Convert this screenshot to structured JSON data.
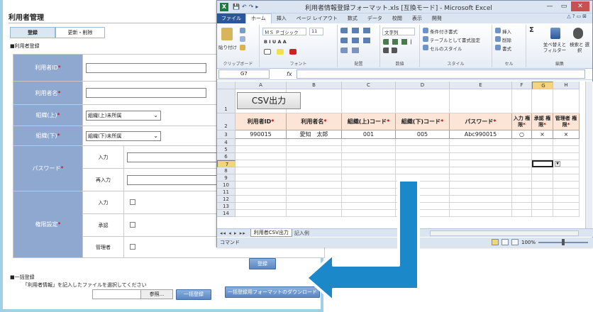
{
  "web": {
    "page_title": "利用者管理",
    "tabs": [
      {
        "label": "登録"
      },
      {
        "label": "更新・削除"
      }
    ],
    "section_label": "■利用者登録",
    "form": {
      "user_id_label": "利用者ID",
      "user_name_label": "利用者名",
      "org_upper_label": "組織(上)",
      "org_upper_value": "組織(上)未所属",
      "org_lower_label": "組織(下)",
      "org_lower_value": "組織(下)未所属",
      "password_label": "パスワード",
      "password_input_label": "入力",
      "password_reenter_label": "再入力",
      "permission_label": "権限設定",
      "perm_input_label": "入力",
      "perm_approve_label": "承認",
      "perm_admin_label": "管理者",
      "required_mark": "*"
    },
    "register_button": "登録",
    "bulk": {
      "title": "■一括登録",
      "description": "「利用者情報」を記入したファイルを選択してください",
      "browse_button": "参照...",
      "bulk_register_button": "一括登録",
      "download_button": "一括登録用フォーマットのダウンロード"
    }
  },
  "excel": {
    "icon_letter": "X",
    "qat": "💾↶↷▸",
    "title": "利用者情報登録フォーマット.xls [互換モード] - Microsoft Excel",
    "window_controls": {
      "minimize": "—",
      "restore": "▭",
      "close": "✕"
    },
    "menu": {
      "file": "ファイル",
      "items": [
        "ホーム",
        "挿入",
        "ページ レイアウト",
        "数式",
        "データ",
        "校閲",
        "表示",
        "開発"
      ],
      "right_icons": "△?▭⊠"
    },
    "ribbon": {
      "paste": "貼り付け",
      "clipboard_group": "クリップボード",
      "font_name": "ＭＳ Ｐゴシック",
      "font_size": "11",
      "font_group": "フォント",
      "font_styles": "B  I  U  A  A",
      "alignment_group": "配置",
      "number_format": "文字列",
      "number_group": "数値",
      "conditional_format": "条件付き書式",
      "format_as_table": "テーブルとして書式設定",
      "cell_styles": "セルのスタイル",
      "style_group": "スタイル",
      "insert": "挿入",
      "delete": "削除",
      "format": "書式",
      "cells_group": "セル",
      "sigma": "Σ",
      "sort_filter": "並べ替えと フィルター",
      "find_select": "検索と 選択",
      "editing_group": "編集"
    },
    "name_box": "G7",
    "fx": "fx",
    "columns": [
      "A",
      "B",
      "C",
      "D",
      "E",
      "F",
      "G",
      "H"
    ],
    "rows": [
      "1",
      "2",
      "3",
      "4",
      "5",
      "6",
      "7",
      "8",
      "9",
      "10",
      "11",
      "12",
      "13",
      "14"
    ],
    "csv_button": "CSV出力",
    "headers": [
      {
        "text": "利用者ID",
        "req": "*"
      },
      {
        "text": "利用者名",
        "req": "*"
      },
      {
        "text": "組織(上)コード",
        "req": "*"
      },
      {
        "text": "組織(下)コード",
        "req": "*"
      },
      {
        "text": "パスワード",
        "req": "*"
      },
      {
        "text": "入力 権限",
        "req": "*"
      },
      {
        "text": "承認 権限",
        "req": "*"
      },
      {
        "text": "管理者 権限",
        "req": "*"
      }
    ],
    "data_row": [
      "990015",
      "愛知　太郎",
      "001",
      "005",
      "Abc990015",
      "○",
      "×",
      "×"
    ],
    "sheet_nav": "◂◂ ◂ ▸ ▸▸",
    "sheet_tabs": [
      "利用者CSV出力",
      "記入例"
    ],
    "status_mode": "コマンド",
    "zoom": "100%"
  }
}
